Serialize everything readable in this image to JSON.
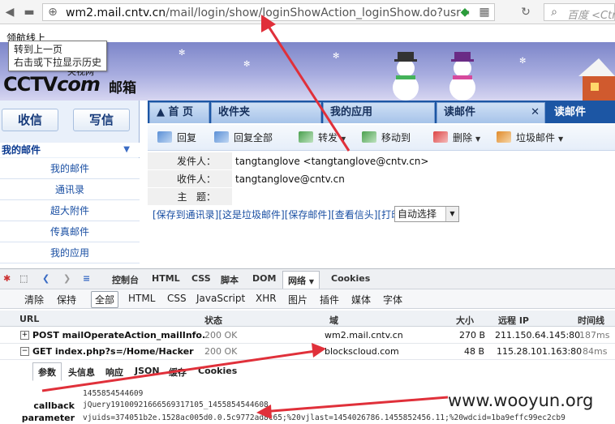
{
  "browser": {
    "url_host": "wm2.mail.cntv.cn",
    "url_path": "/mail/login/show/loginShowAction_loginShow.do?usr=",
    "search_placeholder": "百度 <Ctrl"
  },
  "bookmark_bar": {
    "text": "领航线上"
  },
  "tooltip": {
    "line1": "转到上一页",
    "line2": "右击或下拉显示历史"
  },
  "mail_header": {
    "logo_text": "CCTV",
    "logo_com": "com",
    "logo_cn": "央视网",
    "product": "邮箱"
  },
  "sidebar": {
    "inbox_button": "收信",
    "compose_button": "写信",
    "section_title": "我的邮件",
    "items": [
      "我的邮件",
      "通讯录",
      "超大附件",
      "传真邮件",
      "我的应用"
    ]
  },
  "tabs": [
    {
      "label": "首 页"
    },
    {
      "label": "收件夹"
    },
    {
      "label": "我的应用"
    },
    {
      "label": "读邮件"
    },
    {
      "label": "读邮件"
    }
  ],
  "toolbar": {
    "reply": "回复",
    "reply_all": "回复全部",
    "forward": "转发",
    "move_to": "移动到",
    "delete": "删除",
    "spam": "垃圾邮件"
  },
  "mail": {
    "from_label": "发件人：",
    "from_value": "tangtanglove <tangtanglove@cntv.cn>",
    "to_label": "收件人：",
    "to_value": "tangtanglove@cntv.cn",
    "subject_label": "主   题：",
    "subject_value": "",
    "actions": "[保存到通讯录][这是垃圾邮件][保存邮件][查看信头][打印]",
    "encoding": "自动选择"
  },
  "devtools": {
    "top_tabs": [
      "控制台",
      "HTML",
      "CSS",
      "脚本",
      "DOM",
      "网络",
      "Cookies"
    ],
    "filter_tabs": [
      "清除",
      "保持",
      "全部",
      "HTML",
      "CSS",
      "JavaScript",
      "XHR",
      "图片",
      "插件",
      "媒体",
      "字体"
    ],
    "columns": {
      "url": "URL",
      "status": "状态",
      "domain": "域",
      "size": "大小",
      "remote_ip": "远程 IP",
      "timeline": "时间线"
    },
    "requests": [
      {
        "expand": "+",
        "url": "POST mailOperateAction_mailInfo.",
        "status": "200 OK",
        "domain": "wm2.mail.cntv.cn",
        "size": "270 B",
        "ip": "211.150.64.145:80",
        "time": "187ms"
      },
      {
        "expand": "−",
        "url": "GET index.php?s=/Home/Hacker",
        "status": "200 OK",
        "domain": "blockscloud.com",
        "size": "48 B",
        "ip": "115.28.101.163:80",
        "time": "84ms"
      }
    ],
    "detail_tabs": [
      "参数",
      "头信息",
      "响应",
      "JSON",
      "缓存",
      "Cookies"
    ],
    "params": [
      {
        "name": "",
        "value": "1455854544609"
      },
      {
        "name": "callback",
        "value": "jQuery19100921666569317105_1455854544608"
      },
      {
        "name": "parameter",
        "value": "vjuids=374051b2e.1528ac005d0.0.5c9772ad8c65;%20vjlast=1454026786.1455852456.11;%20wdcid=1ba9effc99ec2cb9"
      }
    ]
  },
  "watermark": "www.wooyun.org",
  "colors": {
    "tab_blue": "#1c56a4",
    "link_blue": "#1a4fa3",
    "arrow_red": "#e0303a"
  }
}
